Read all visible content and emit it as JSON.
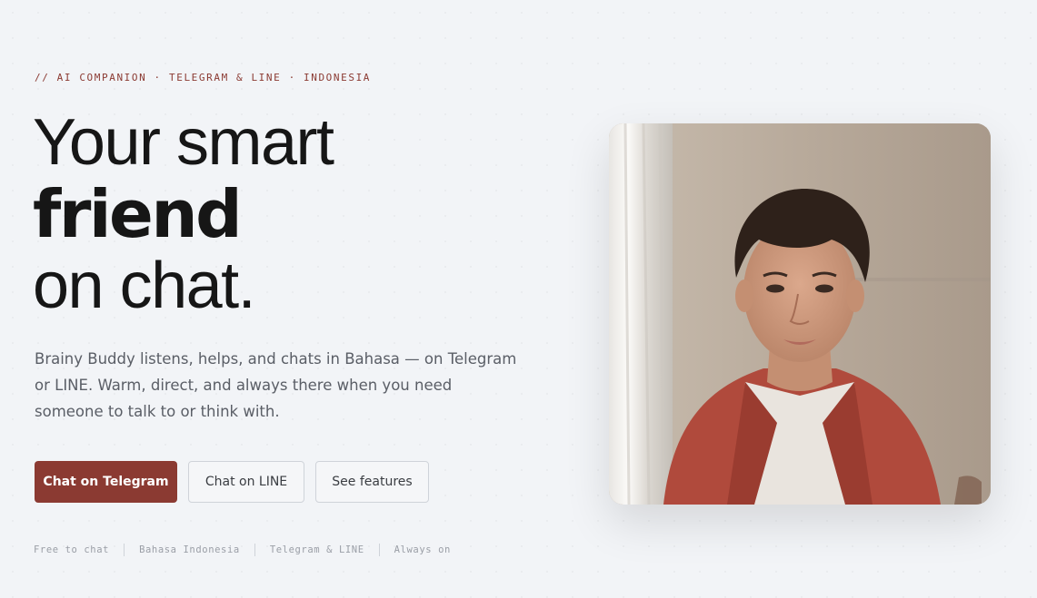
{
  "hero": {
    "eyebrow": "// AI COMPANION · TELEGRAM & LINE · INDONESIA",
    "headline_line1": "Your smart",
    "headline_line2": "friend",
    "headline_line3": "on chat.",
    "lead": "Brainy Buddy listens, helps, and chats in Bahasa — on Telegram or LINE. Warm, direct, and always there when you need someone to talk to or think with."
  },
  "actions": {
    "telegram_label": "Chat on Telegram",
    "line_label": "Chat on LINE",
    "features_label": "See features"
  },
  "meta": {
    "items": [
      "Free to chat",
      "Bahasa Indonesia",
      "Telegram & LINE",
      "Always on"
    ]
  },
  "colors": {
    "accent": "#8b3a32",
    "background": "#f2f4f7",
    "text": "#161616",
    "muted": "#5a5e66"
  }
}
